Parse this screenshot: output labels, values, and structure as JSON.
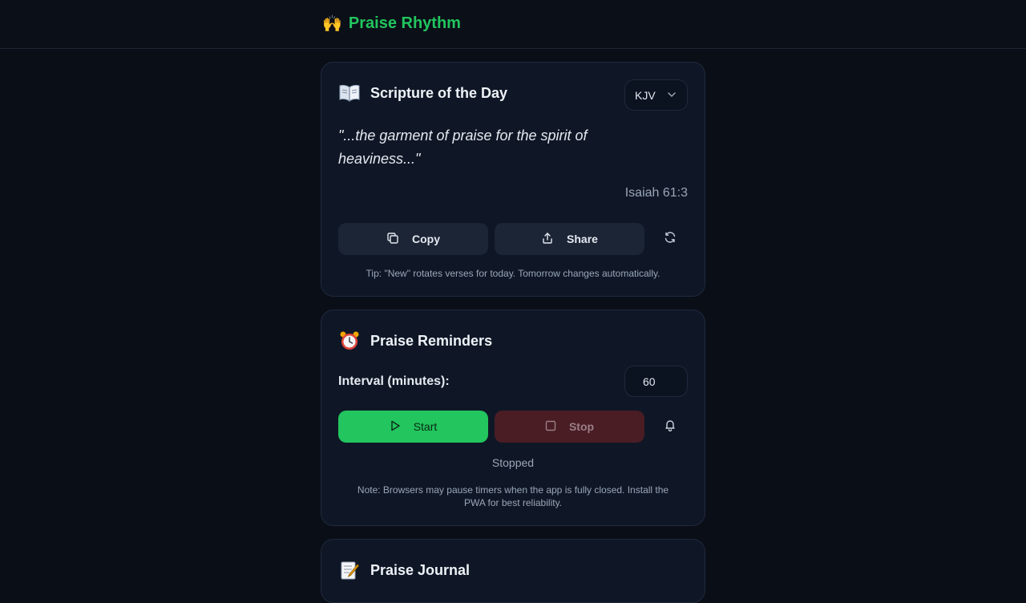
{
  "app": {
    "brand_emoji": "🙌",
    "brand_name": "Praise Rhythm",
    "accent_color": "#22c55e"
  },
  "scripture_card": {
    "icon": "open-book-icon",
    "title": "Scripture of the Day",
    "version_selected": "KJV",
    "verse_text": "\"...the garment of praise for the spirit of heaviness...\"",
    "reference": "Isaiah 61:3",
    "copy_label": "Copy",
    "share_label": "Share",
    "tip": "Tip: \"New\" rotates verses for today. Tomorrow changes automatically."
  },
  "reminders_card": {
    "icon": "alarm-clock-icon",
    "title": "Praise Reminders",
    "interval_label": "Interval (minutes):",
    "interval_value": "60",
    "start_label": "Start",
    "stop_label": "Stop",
    "status": "Stopped",
    "note": "Note: Browsers may pause timers when the app is fully closed. Install the PWA for best reliability."
  },
  "journal_card": {
    "icon": "memo-icon",
    "title": "Praise Journal"
  }
}
